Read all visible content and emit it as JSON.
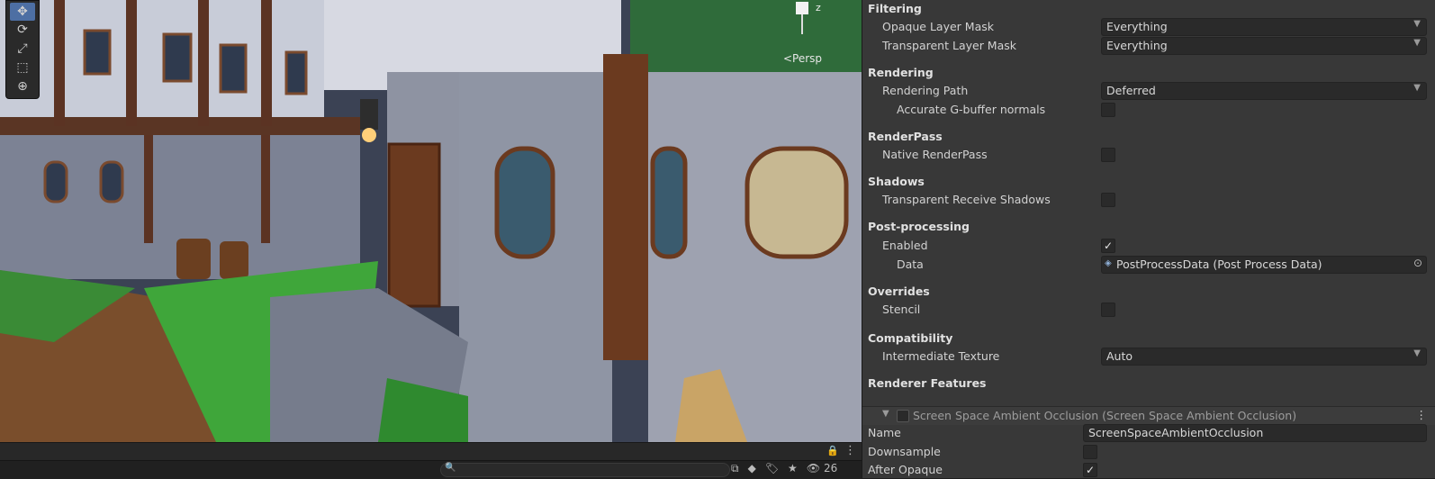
{
  "scene": {
    "tools": [
      "move-icon",
      "rotate-icon",
      "scale-icon",
      "rect-icon",
      "transform-icon"
    ],
    "gizmo_axis": "z",
    "persp_label": "<Persp",
    "bottom_count": "26"
  },
  "inspector": {
    "filtering_header": "Filtering",
    "opaque_label": "Opaque Layer Mask",
    "opaque_value": "Everything",
    "transparent_label": "Transparent Layer Mask",
    "transparent_value": "Everything",
    "rendering_header": "Rendering",
    "rendering_path_label": "Rendering Path",
    "rendering_path_value": "Deferred",
    "gbuffer_label": "Accurate G-buffer normals",
    "renderpass_header": "RenderPass",
    "native_renderpass_label": "Native RenderPass",
    "shadows_header": "Shadows",
    "transparent_shadows_label": "Transparent Receive Shadows",
    "postprocessing_header": "Post-processing",
    "enabled_label": "Enabled",
    "data_label": "Data",
    "data_value": "PostProcessData (Post Process Data)",
    "overrides_header": "Overrides",
    "stencil_label": "Stencil",
    "compat_header": "Compatibility",
    "intermediate_label": "Intermediate Texture",
    "intermediate_value": "Auto",
    "renderer_features_header": "Renderer Features",
    "feature_title": "Screen Space Ambient Occlusion (Screen Space Ambient Occlusion)",
    "name_label": "Name",
    "name_value": "ScreenSpaceAmbientOcclusion",
    "downsample_label": "Downsample",
    "after_opaque_label": "After Opaque"
  },
  "checkmark": "✓"
}
